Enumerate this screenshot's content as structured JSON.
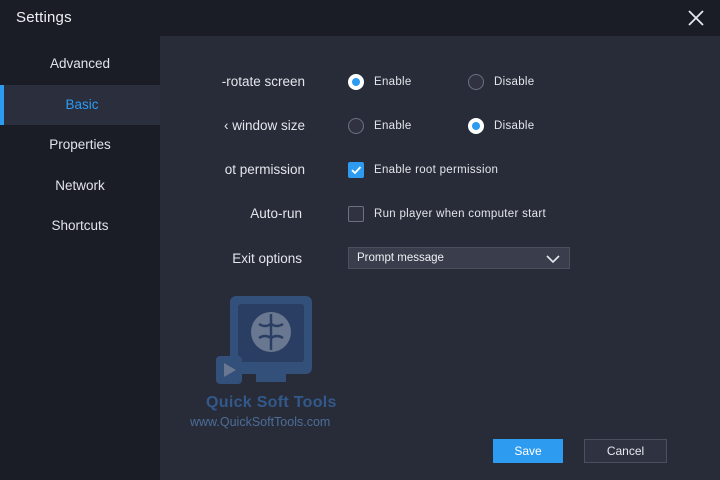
{
  "window": {
    "title": "Settings"
  },
  "sidebar": {
    "items": [
      {
        "label": "Advanced",
        "active": false
      },
      {
        "label": "Basic",
        "active": true
      },
      {
        "label": "Properties",
        "active": false
      },
      {
        "label": "Network",
        "active": false
      },
      {
        "label": "Shortcuts",
        "active": false
      }
    ]
  },
  "settings": {
    "auto_rotate": {
      "label": "-rotate screen",
      "options": [
        "Enable",
        "Disable"
      ],
      "selected": "Enable"
    },
    "window_size": {
      "label": "‹ window size",
      "options": [
        "Enable",
        "Disable"
      ],
      "selected": "Disable"
    },
    "root_permission": {
      "label": "ot permission",
      "checkbox_label": "Enable root permission",
      "checked": true
    },
    "auto_run": {
      "label": "Auto-run",
      "checkbox_label": "Run player when computer start",
      "checked": false
    },
    "exit_options": {
      "label": "Exit options",
      "selected": "Prompt message"
    }
  },
  "buttons": {
    "save": "Save",
    "cancel": "Cancel"
  },
  "watermark": {
    "brand": "Quick Soft Tools",
    "url": "www.QuickSoftTools.com"
  },
  "colors": {
    "accent": "#2d9cf0",
    "panel": "#282b38",
    "background": "#1b1d26"
  }
}
